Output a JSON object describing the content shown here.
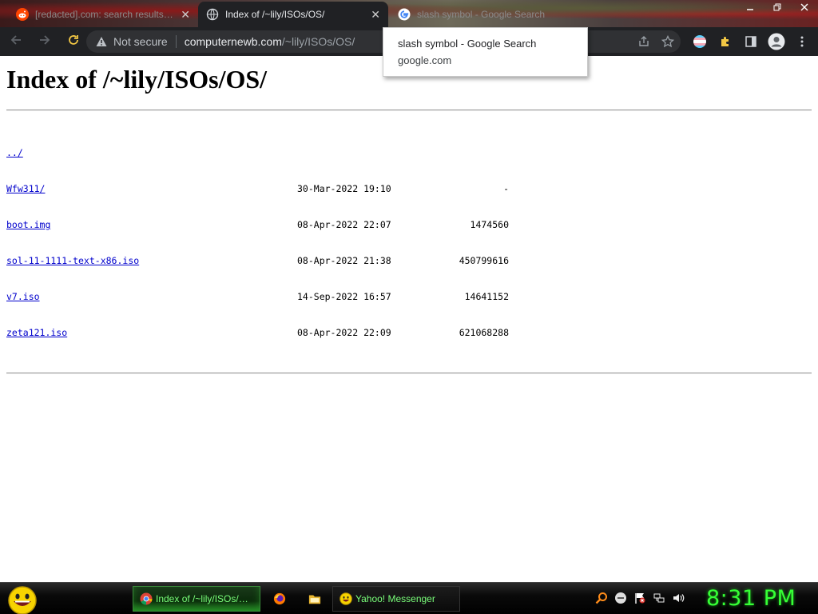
{
  "browser": {
    "tabs": [
      {
        "label": "[redacted].com: search results - Pro",
        "icon": "reddit-icon",
        "active": false
      },
      {
        "label": "Index of /~lily/ISOs/OS/",
        "icon": "globe-icon",
        "active": true
      },
      {
        "label": "slash symbol - Google Search",
        "icon": "google-icon",
        "active": false
      }
    ],
    "tab_close_glyph": "✕",
    "tooltip": {
      "title": "slash symbol - Google Search",
      "domain": "google.com"
    },
    "address": {
      "security": "Not secure",
      "domain": "computernewb.com",
      "path": "/~lily/ISOs/OS/"
    }
  },
  "page": {
    "title": "Index of /~lily/ISOs/OS/",
    "parent_link": "../",
    "entries": [
      {
        "name": "Wfw311/",
        "date": "30-Mar-2022 19:10",
        "size": "-"
      },
      {
        "name": "boot.img",
        "date": "08-Apr-2022 22:07",
        "size": "1474560"
      },
      {
        "name": "sol-11-1111-text-x86.iso",
        "date": "08-Apr-2022 21:38",
        "size": "450799616"
      },
      {
        "name": "v7.iso",
        "date": "14-Sep-2022 16:57",
        "size": "14641152"
      },
      {
        "name": "zeta121.iso",
        "date": "08-Apr-2022 22:09",
        "size": "621068288"
      }
    ]
  },
  "taskbar": {
    "tasks": {
      "chrome": "Index of /~lily/ISOs/O...",
      "yahoo": "Yahoo! Messenger"
    },
    "clock": "8:31 PM"
  },
  "colors": {
    "link": "#0000cc",
    "clock": "#36ff36",
    "toolbar_bg": "#202124"
  }
}
